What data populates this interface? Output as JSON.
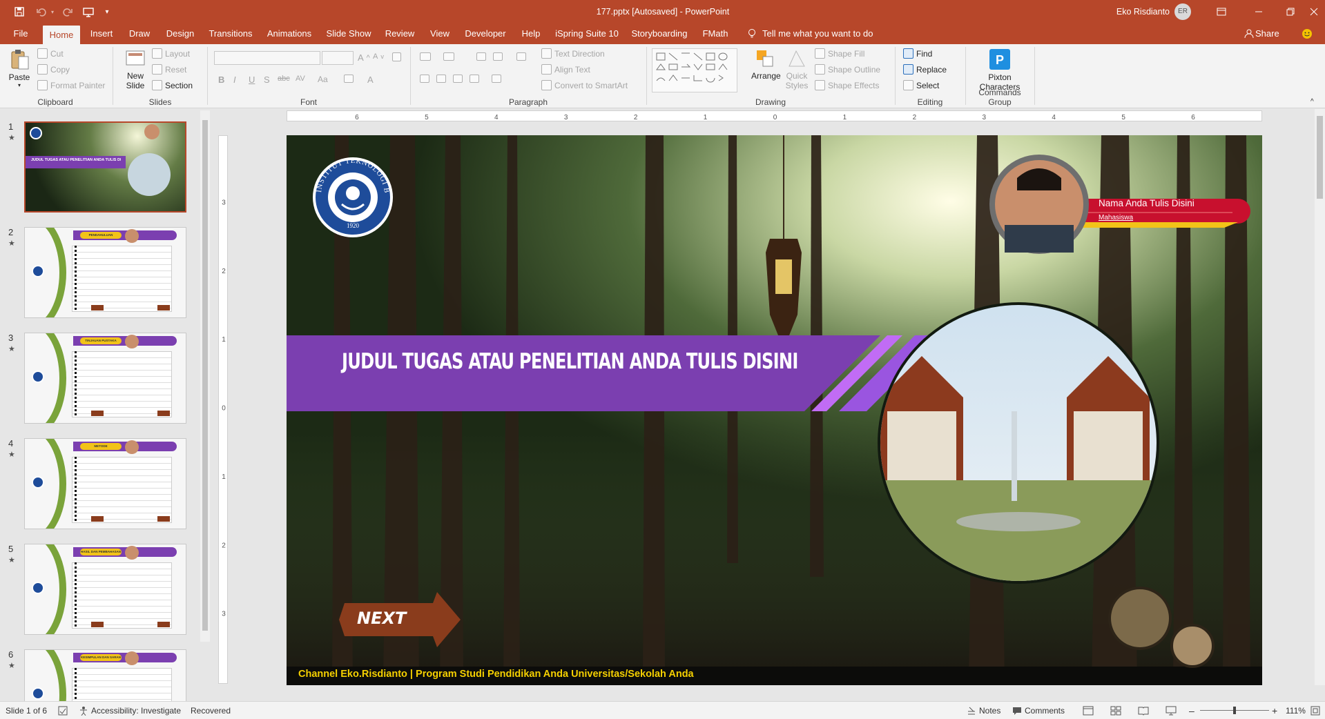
{
  "window": {
    "title": "177.pptx [Autosaved] - PowerPoint",
    "user": "Eko Risdianto",
    "user_initials": "ER",
    "share": "Share",
    "tell_me": "Tell me what you want to do"
  },
  "tabs": [
    "File",
    "Home",
    "Insert",
    "Draw",
    "Design",
    "Transitions",
    "Animations",
    "Slide Show",
    "Review",
    "View",
    "Developer",
    "Help",
    "iSpring Suite 10",
    "Storyboarding",
    "FMath"
  ],
  "ribbon": {
    "clipboard": {
      "paste": "Paste",
      "cut": "Cut",
      "copy": "Copy",
      "format_painter": "Format Painter",
      "label": "Clipboard"
    },
    "slides": {
      "new_slide_1": "New",
      "new_slide_2": "Slide",
      "layout": "Layout",
      "reset": "Reset",
      "section": "Section",
      "label": "Slides"
    },
    "font": {
      "label": "Font"
    },
    "paragraph": {
      "text_direction": "Text Direction",
      "align_text": "Align Text",
      "convert_smartart": "Convert to SmartArt",
      "label": "Paragraph"
    },
    "drawing": {
      "arrange": "Arrange",
      "quick_1": "Quick",
      "quick_2": "Styles",
      "shape_fill": "Shape Fill",
      "shape_outline": "Shape Outline",
      "shape_effects": "Shape Effects",
      "label": "Drawing"
    },
    "editing": {
      "find": "Find",
      "replace": "Replace",
      "select": "Select",
      "label": "Editing"
    },
    "commands": {
      "pixton_1": "Pixton",
      "pixton_2": "Characters",
      "label": "Commands Group"
    }
  },
  "ruler": {
    "top": [
      "6",
      "5",
      "4",
      "3",
      "2",
      "1",
      "0",
      "1",
      "2",
      "3",
      "4",
      "5",
      "6"
    ],
    "left": [
      "3",
      "2",
      "1",
      "0",
      "1",
      "2",
      "3"
    ]
  },
  "thumbnails": [
    {
      "num": "1",
      "title": "JUDUL TUGAS ATAU PENELITIAN ANDA TULIS DISINI"
    },
    {
      "num": "2",
      "title": "PENDAHULUAN"
    },
    {
      "num": "3",
      "title": "TINJAUAN PUSTAKA"
    },
    {
      "num": "4",
      "title": "METODE"
    },
    {
      "num": "5",
      "title": "HASIL DAN PEMBAHASAN"
    },
    {
      "num": "6",
      "title": "KESIMPULAN DAN SARAN"
    }
  ],
  "slide": {
    "logo_text": "INSTITUT TEKNOLOGI BANDUNG",
    "logo_year": "1920",
    "title": "JUDUL TUGAS ATAU  PENELITIAN ANDA TULIS DISINI",
    "name": "Nama Anda Tulis Disini",
    "role": "Mahasiswa",
    "next": "NEXT",
    "footer": "Channel Eko.Risdianto | Program Studi Pendidikan Anda Universitas/Sekolah Anda"
  },
  "status": {
    "slide": "Slide 1 of 6",
    "accessibility": "Accessibility: Investigate",
    "recovered": "Recovered",
    "notes": "Notes",
    "comments": "Comments",
    "zoom": "111%"
  },
  "colors": {
    "accent": "#b7472a",
    "banner": "#7b3fb0",
    "name_badge": "#c8102e",
    "footer_text": "#f5d000"
  }
}
